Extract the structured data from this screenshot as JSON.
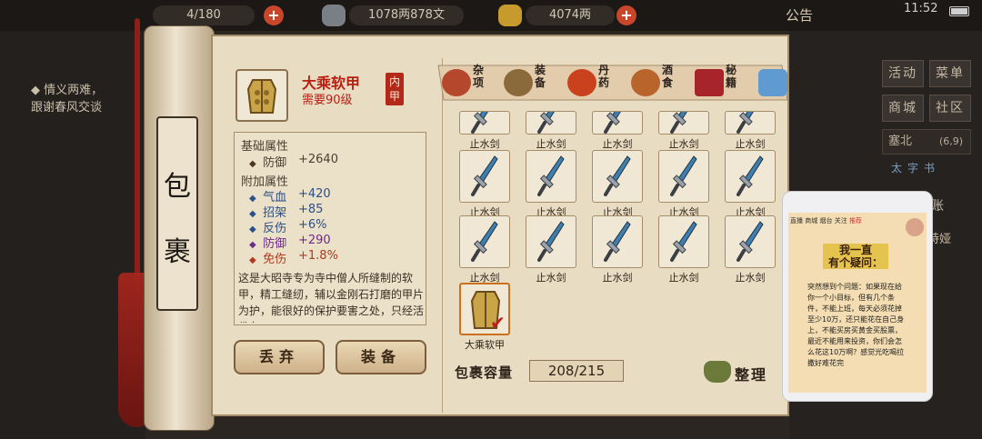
{
  "topbar": {
    "bag_count": "4/180",
    "silver": "1078两878文",
    "gold": "4074两",
    "announcement": "公告",
    "time": "11:52"
  },
  "quest": {
    "line1": "◆ 情义两难，",
    "line2": "跟谢春风交谈"
  },
  "scroll": {
    "char1": "包",
    "char2": "裹"
  },
  "item": {
    "name": "大乘软甲",
    "requirement": "需要90级",
    "type_seal": "内甲",
    "base_header": "基础属性",
    "base_attrs": [
      {
        "name": "防御",
        "value": "+2640"
      }
    ],
    "extra_header": "附加属性",
    "extra_attrs": [
      {
        "name": "气血",
        "value": "+420"
      },
      {
        "name": "招架",
        "value": "+85"
      },
      {
        "name": "反伤",
        "value": "+6%"
      },
      {
        "name": "防御",
        "value": "+290"
      },
      {
        "name": "免伤",
        "value": "+1.8%"
      }
    ],
    "description": "这是大昭寺专为寺中僧人所缝制的软甲，精工缝纫，辅以金刚石打磨的甲片为护，能很好的保护要害之处，只经活佛各"
  },
  "actions": {
    "discard": "丢弃",
    "equip": "装备"
  },
  "tabs": [
    {
      "label": "杂项",
      "icon": "jar-icon"
    },
    {
      "label": "装备",
      "icon": "weapons-icon"
    },
    {
      "label": "丹药",
      "icon": "pills-icon"
    },
    {
      "label": "酒食",
      "icon": "wine-food-icon"
    },
    {
      "label": "秘籍",
      "icon": "books-icon"
    },
    {
      "label": "材料",
      "icon": "crystal-icon"
    }
  ],
  "grid": {
    "rows": [
      [
        "止水剑",
        "止水剑",
        "止水剑",
        "止水剑",
        "止水剑"
      ],
      [
        "止水剑",
        "止水剑",
        "止水剑",
        "止水剑",
        "止水剑"
      ],
      [
        "止水剑",
        "止水剑",
        "止水剑",
        "止水剑",
        "止水剑"
      ],
      [
        "大乘软甲"
      ]
    ]
  },
  "capacity": {
    "label": "包裹容量",
    "value": "208/215"
  },
  "sort_label": "整理",
  "right_menu": {
    "buttons": [
      "活动",
      "菜单",
      "商城",
      "社区"
    ],
    "location": "塞北",
    "coords": "(6,9)",
    "tabs": [
      "太",
      "字",
      "书"
    ],
    "side1": "账",
    "side2": "特娅"
  },
  "phone": {
    "nav": [
      "直播",
      "商城",
      "烟台",
      "关注",
      "推荐"
    ],
    "title_line1": "我一直",
    "title_line2": "有个疑问：",
    "text": "突然想到个问题：如果现在给你一个小目标，但有几个条件，不能上班，每天必须花掉至少10万，还只能花在自己身上，不能买房买黄金买股票，最近不能用来投资，你们会怎么花这10万啊？感觉光吃喝拉撒好难花完"
  },
  "colors": {
    "accent_red": "#b81f13",
    "parchment": "#e8dcc3",
    "sword_blue": "#3f7fae"
  }
}
